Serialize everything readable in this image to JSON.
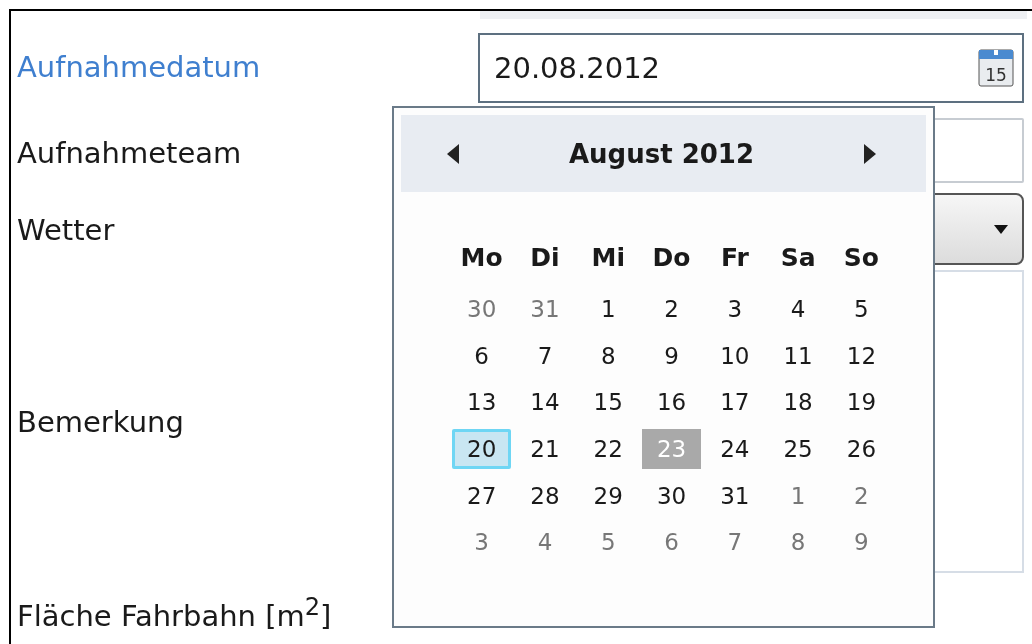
{
  "form": {
    "fields": [
      {
        "kind": "date",
        "label": "Aufnahmedatum",
        "focused": true,
        "value": "20.08.2012"
      },
      {
        "kind": "text",
        "label": "Aufnahmeteam",
        "focused": false
      },
      {
        "kind": "combo",
        "label": "Wetter",
        "focused": false
      },
      {
        "kind": "textarea",
        "label": "Bemerkung",
        "focused": false
      },
      {
        "kind": "label",
        "label": "Fläche Fahrbahn [m$^{2}$]",
        "focused": false
      }
    ]
  },
  "calendar": {
    "icon_day": "15",
    "month": "August 2012",
    "weekdays": [
      "Mo",
      "Di",
      "Mi",
      "Do",
      "Fr",
      "Sa",
      "So"
    ],
    "weeks": [
      [
        {
          "text": "30",
          "outside": true,
          "selected": false,
          "today": false
        },
        {
          "text": "31",
          "outside": true,
          "selected": false,
          "today": false
        },
        {
          "text": "1",
          "outside": false,
          "selected": false,
          "today": false
        },
        {
          "text": "2",
          "outside": false,
          "selected": false,
          "today": false
        },
        {
          "text": "3",
          "outside": false,
          "selected": false,
          "today": false
        },
        {
          "text": "4",
          "outside": false,
          "selected": false,
          "today": false
        },
        {
          "text": "5",
          "outside": false,
          "selected": false,
          "today": false
        }
      ],
      [
        {
          "text": "6",
          "outside": false,
          "selected": false,
          "today": false
        },
        {
          "text": "7",
          "outside": false,
          "selected": false,
          "today": false
        },
        {
          "text": "8",
          "outside": false,
          "selected": false,
          "today": false
        },
        {
          "text": "9",
          "outside": false,
          "selected": false,
          "today": false
        },
        {
          "text": "10",
          "outside": false,
          "selected": false,
          "today": false
        },
        {
          "text": "11",
          "outside": false,
          "selected": false,
          "today": false
        },
        {
          "text": "12",
          "outside": false,
          "selected": false,
          "today": false
        }
      ],
      [
        {
          "text": "13",
          "outside": false,
          "selected": false,
          "today": false
        },
        {
          "text": "14",
          "outside": false,
          "selected": false,
          "today": false
        },
        {
          "text": "15",
          "outside": false,
          "selected": false,
          "today": false
        },
        {
          "text": "16",
          "outside": false,
          "selected": false,
          "today": false
        },
        {
          "text": "17",
          "outside": false,
          "selected": false,
          "today": false
        },
        {
          "text": "18",
          "outside": false,
          "selected": false,
          "today": false
        },
        {
          "text": "19",
          "outside": false,
          "selected": false,
          "today": false
        }
      ],
      [
        {
          "text": "20",
          "outside": false,
          "selected": true,
          "today": false
        },
        {
          "text": "21",
          "outside": false,
          "selected": false,
          "today": false
        },
        {
          "text": "22",
          "outside": false,
          "selected": false,
          "today": false
        },
        {
          "text": "23",
          "outside": false,
          "selected": false,
          "today": true
        },
        {
          "text": "24",
          "outside": false,
          "selected": false,
          "today": false
        },
        {
          "text": "25",
          "outside": false,
          "selected": false,
          "today": false
        },
        {
          "text": "26",
          "outside": false,
          "selected": false,
          "today": false
        }
      ],
      [
        {
          "text": "27",
          "outside": false,
          "selected": false,
          "today": false
        },
        {
          "text": "28",
          "outside": false,
          "selected": false,
          "today": false
        },
        {
          "text": "29",
          "outside": false,
          "selected": false,
          "today": false
        },
        {
          "text": "30",
          "outside": false,
          "selected": false,
          "today": false
        },
        {
          "text": "31",
          "outside": false,
          "selected": false,
          "today": false
        },
        {
          "text": "1",
          "outside": true,
          "selected": false,
          "today": false
        },
        {
          "text": "2",
          "outside": true,
          "selected": false,
          "today": false
        }
      ],
      [
        {
          "text": "3",
          "outside": true,
          "selected": false,
          "today": false
        },
        {
          "text": "4",
          "outside": true,
          "selected": false,
          "today": false
        },
        {
          "text": "5",
          "outside": true,
          "selected": false,
          "today": false
        },
        {
          "text": "6",
          "outside": true,
          "selected": false,
          "today": false
        },
        {
          "text": "7",
          "outside": true,
          "selected": false,
          "today": false
        },
        {
          "text": "8",
          "outside": true,
          "selected": false,
          "today": false
        },
        {
          "text": "9",
          "outside": true,
          "selected": false,
          "today": false
        }
      ]
    ]
  }
}
